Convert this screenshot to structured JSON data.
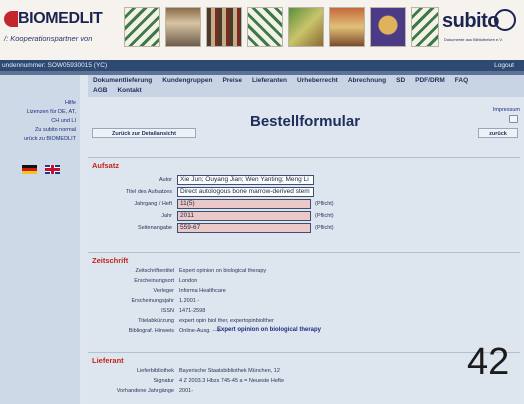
{
  "header": {
    "logo_title": "BIOMEDLIT",
    "logo_subtitle": "/: Kooperationspartner von",
    "subito_logo": "subito",
    "subito_tagline": "Dokumente aus Bibliotheken e.V."
  },
  "topbar": {
    "customer_number": "undennummer: SOW05930015 (YC)",
    "logout": "Logout"
  },
  "nav": {
    "row1": [
      "Dokumentlieferung",
      "Kundengruppen",
      "Preise",
      "Lieferanten",
      "Urheberrecht",
      "Abrechnung",
      "SD",
      "PDF/DRM",
      "FAQ"
    ],
    "row2": [
      "AGB",
      "Kontakt"
    ]
  },
  "sidebar": {
    "links": [
      "Hilfe",
      "Lizenzen für DE, AT,",
      "CH und LI",
      "Zu subito normal",
      "urück zu BIOMEDLIT"
    ],
    "flags": [
      "flag-de",
      "flag-uk"
    ]
  },
  "main": {
    "title": "Bestellformular",
    "impressum": "Impressum",
    "back_button": "Zurück zur Detailansicht",
    "zurueck_button": "zurück"
  },
  "aufsatz": {
    "title": "Aufsatz",
    "fields": [
      {
        "label": "Autor",
        "value": "Xie Jun; Ouyang Jian; Wen Yanting; Meng Li",
        "required": ""
      },
      {
        "label": "Titel des Aufsatzes",
        "value": "Direct autologous bone marrow-derived stem",
        "required": ""
      },
      {
        "label": "Jahrgang / Heft",
        "value": "11(5)",
        "required": "(Pflicht)"
      },
      {
        "label": "Jahr",
        "value": "2011",
        "required": "(Pflicht)"
      },
      {
        "label": "Seitenangabe",
        "value": "559-67",
        "required": "(Pflicht)"
      }
    ]
  },
  "zeitschrift": {
    "title": "Zeitschrift",
    "rows": [
      {
        "label": "Zeitschriftentitel",
        "value": "Expert opinion on biological therapy"
      },
      {
        "label": "Erscheinungsort",
        "value": "London"
      },
      {
        "label": "Verleger",
        "value": "Informa Healthcare"
      },
      {
        "label": "Erscheinungsjahr",
        "value": "1.2001 -"
      },
      {
        "label": "ISSN",
        "value": "1471-2598"
      },
      {
        "label": "Titelabkürzung",
        "value": "expert opin biol ther, expertopinbiolther"
      },
      {
        "label": "Bibliograf. Hinweis",
        "value": "Online-Ausg. ---> ",
        "link": "Expert opinion on biological therapy"
      }
    ]
  },
  "lieferant": {
    "title": "Lieferant",
    "rows": [
      {
        "label": "Lieferbibliothek",
        "value": "Bayerische Staatsbibliothek München, 12"
      },
      {
        "label": "Signatur",
        "value": "4 Z 2003.3 Hbzs 745-45 a = Neueste Hefte"
      },
      {
        "label": "Vorhandene Jahrgänge",
        "value": "2001-"
      }
    ]
  },
  "page_number": "42"
}
